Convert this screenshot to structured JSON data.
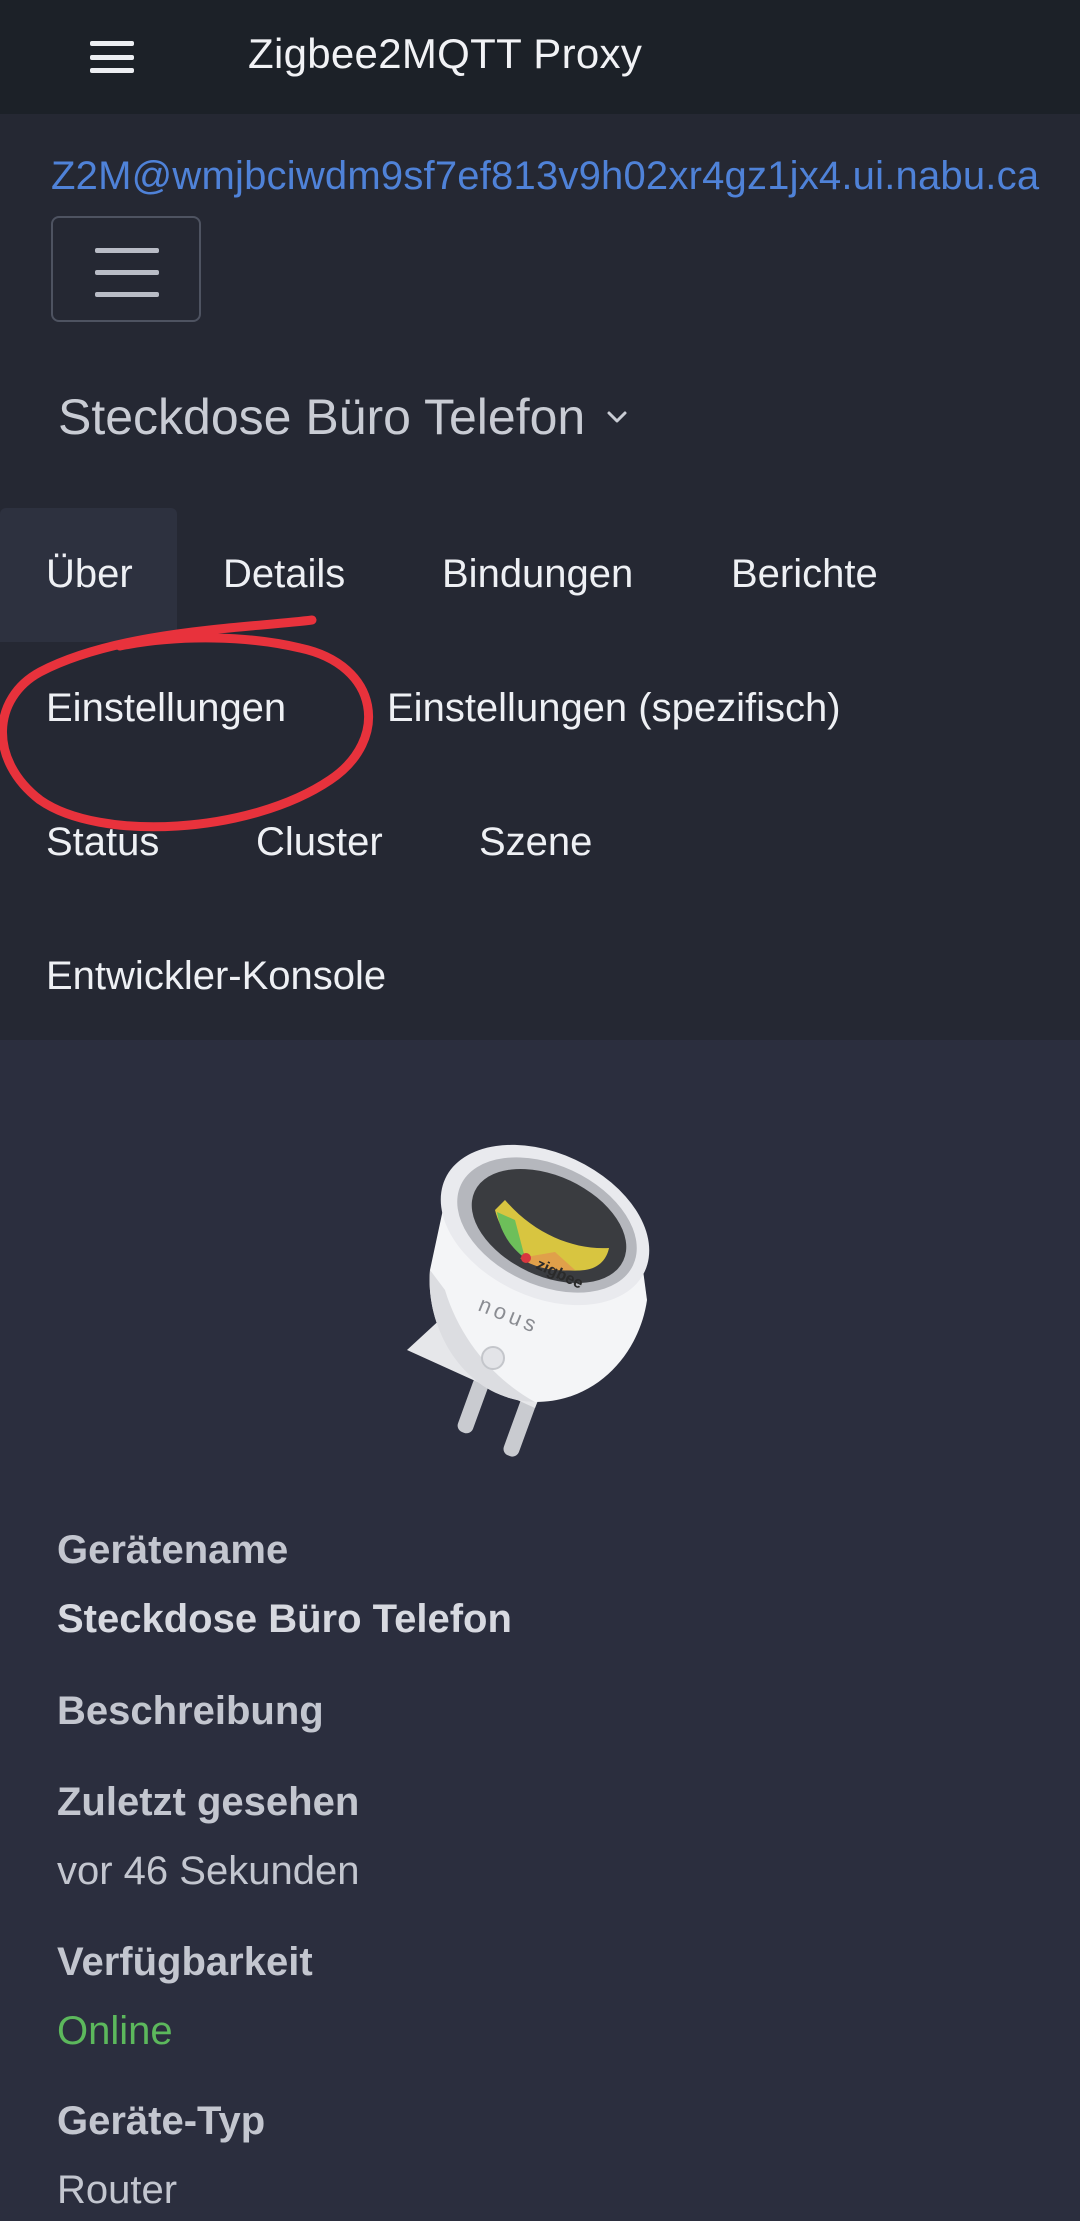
{
  "app": {
    "title": "Zigbee2MQTT Proxy"
  },
  "header": {
    "user_link": "Z2M@wmjbciwdm9sf7ef813v9h02xr4gz1jx4.ui.nabu.ca",
    "device_selector": "Steckdose Büro Telefon"
  },
  "tabs": [
    {
      "label": "Über",
      "active": true
    },
    {
      "label": "Details"
    },
    {
      "label": "Bindungen"
    },
    {
      "label": "Berichte"
    },
    {
      "label": "Einstellungen",
      "annotated": true
    },
    {
      "label": "Einstellungen (spezifisch)"
    },
    {
      "label": "Status"
    },
    {
      "label": "Cluster"
    },
    {
      "label": "Szene"
    },
    {
      "label": "Entwickler-Konsole"
    }
  ],
  "device_image": {
    "brand_text": "zigbee",
    "logo_text": "nous"
  },
  "info": {
    "device_name_label": "Gerätename",
    "device_name_value": "Steckdose Büro Telefon",
    "description_label": "Beschreibung",
    "last_seen_label": "Zuletzt gesehen",
    "last_seen_value": "vor 46 Sekunden",
    "availability_label": "Verfügbarkeit",
    "availability_value": "Online",
    "device_type_label": "Geräte-Typ",
    "device_type_value": "Router"
  },
  "colors": {
    "accent_link": "#4f82d8",
    "online": "#5cb85c",
    "annotation": "#e8323c"
  },
  "icons": [
    "menu-icon",
    "chevron-down-icon"
  ]
}
